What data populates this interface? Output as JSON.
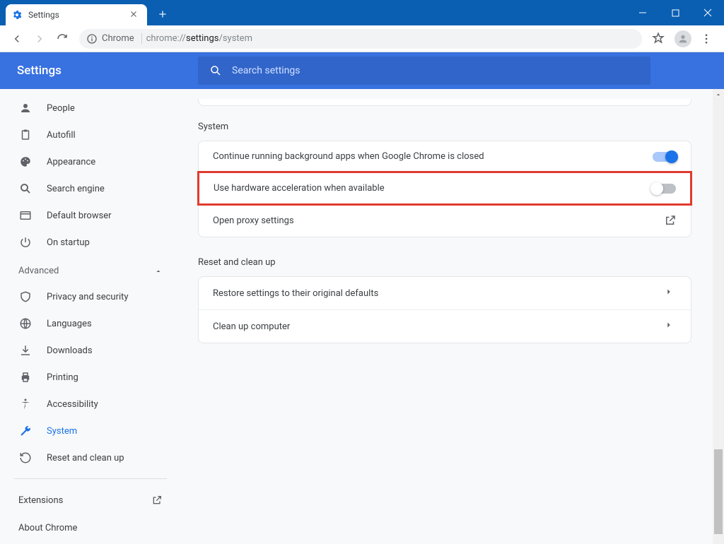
{
  "window": {
    "tab_title": "Settings",
    "new_tab_label": "+"
  },
  "toolbar": {
    "chip": "Chrome",
    "url_prefix": "chrome://",
    "url_bold": "settings",
    "url_suffix": "/system"
  },
  "header": {
    "title": "Settings",
    "search_placeholder": "Search settings"
  },
  "sidebar": {
    "items": [
      {
        "label": "People",
        "icon": "person-icon"
      },
      {
        "label": "Autofill",
        "icon": "clipboard-icon"
      },
      {
        "label": "Appearance",
        "icon": "palette-icon"
      },
      {
        "label": "Search engine",
        "icon": "search-icon"
      },
      {
        "label": "Default browser",
        "icon": "browser-icon"
      },
      {
        "label": "On startup",
        "icon": "power-icon"
      }
    ],
    "advanced_label": "Advanced",
    "advanced_items": [
      {
        "label": "Privacy and security",
        "icon": "shield-icon"
      },
      {
        "label": "Languages",
        "icon": "globe-icon"
      },
      {
        "label": "Downloads",
        "icon": "download-icon"
      },
      {
        "label": "Printing",
        "icon": "printer-icon"
      },
      {
        "label": "Accessibility",
        "icon": "accessibility-icon"
      },
      {
        "label": "System",
        "icon": "wrench-icon"
      },
      {
        "label": "Reset and clean up",
        "icon": "restore-icon"
      }
    ],
    "extensions_label": "Extensions",
    "about_label": "About Chrome"
  },
  "content": {
    "system_title": "System",
    "rows": {
      "bg_apps": "Continue running background apps when Google Chrome is closed",
      "hw_accel": "Use hardware acceleration when available",
      "proxy": "Open proxy settings"
    },
    "reset_title": "Reset and clean up",
    "reset_rows": {
      "restore": "Restore settings to their original defaults",
      "cleanup": "Clean up computer"
    }
  }
}
